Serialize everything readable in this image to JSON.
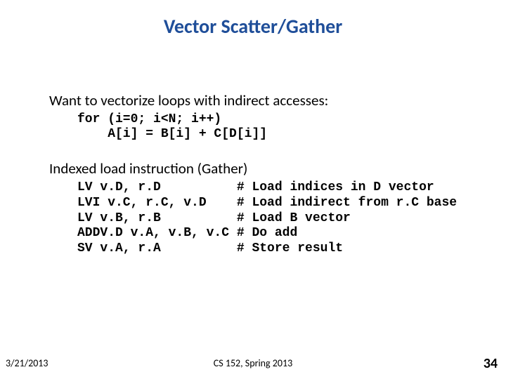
{
  "title": "Vector Scatter/Gather",
  "lead1": "Want to vectorize loops with indirect accesses:",
  "code1": "for (i=0; i<N; i++)\n    A[i] = B[i] + C[D[i]]",
  "lead2": "Indexed load instruction (Gather)",
  "code2": "LV v.D, r.D          # Load indices in D vector\nLVI v.C, r.C, v.D    # Load indirect from r.C base\nLV v.B, r.B          # Load B vector\nADDV.D v.A, v.B, v.C # Do add\nSV v.A, r.A          # Store result",
  "footer": {
    "date": "3/21/2013",
    "center": "CS 152, Spring 2013",
    "page": "34"
  }
}
